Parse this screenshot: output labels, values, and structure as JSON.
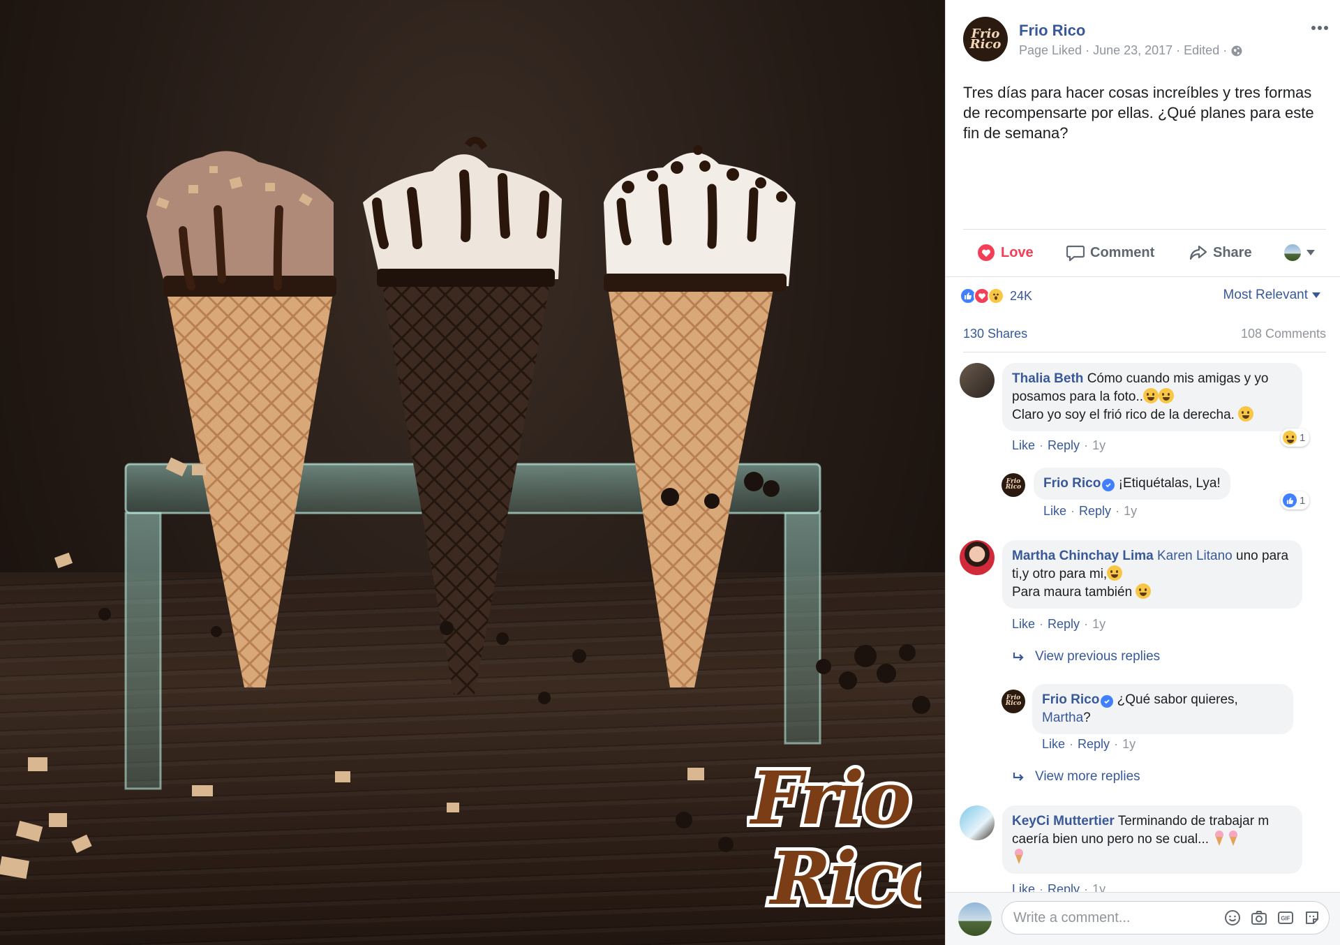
{
  "photo": {
    "logo_line1": "Frio",
    "logo_line2": "Rico"
  },
  "post": {
    "page_name": "Frio Rico",
    "avatar_text_1": "Frio",
    "avatar_text_2": "Rico",
    "meta": "Page Liked · June 23, 2017 · Edited ·",
    "text": "Tres días para hacer cosas increíbles y tres formas de recompensarte por ellas. ¿Qué planes para este fin de semana?"
  },
  "actions": {
    "love": "Love",
    "comment": "Comment",
    "share": "Share"
  },
  "reactions": {
    "count": "24K",
    "sort": "Most Relevant",
    "shares": "130 Shares",
    "comments": "108 Comments"
  },
  "colors": {
    "link": "#385898",
    "love": "#f33e58",
    "like": "#4080ff",
    "muted": "#90949c"
  },
  "comments": [
    {
      "author": "Thalia Beth",
      "text_1": "Cómo cuando mis amigas y yo posamos para la foto..",
      "text_2": "Claro yo soy el frió rico de la derecha.",
      "reaction_count": "1",
      "like": "Like",
      "reply": "Reply",
      "time": "1y"
    },
    {
      "author": "Frio Rico",
      "text": "¡Etiquétalas, Lya!",
      "reaction_count": "1",
      "like": "Like",
      "reply": "Reply",
      "time": "1y"
    },
    {
      "author": "Martha Chinchay Lima",
      "mention": "Karen Litano",
      "text_1": "uno para ti,y otro para mi,",
      "text_2": "Para maura también",
      "like": "Like",
      "reply": "Reply",
      "time": "1y"
    },
    {
      "view_previous": "View previous replies"
    },
    {
      "author": "Frio Rico",
      "text": "¿Qué sabor quieres,",
      "mention": "Martha",
      "suffix": "?",
      "like": "Like",
      "reply": "Reply",
      "time": "1y"
    },
    {
      "view_more": "View more replies"
    },
    {
      "author": "KeyCi Muttertier",
      "text_1": "Terminando de trabajar m caería bien uno pero no se cual...",
      "like": "Like",
      "reply": "Reply",
      "time": "1y"
    }
  ],
  "composer": {
    "placeholder": "Write a comment..."
  }
}
